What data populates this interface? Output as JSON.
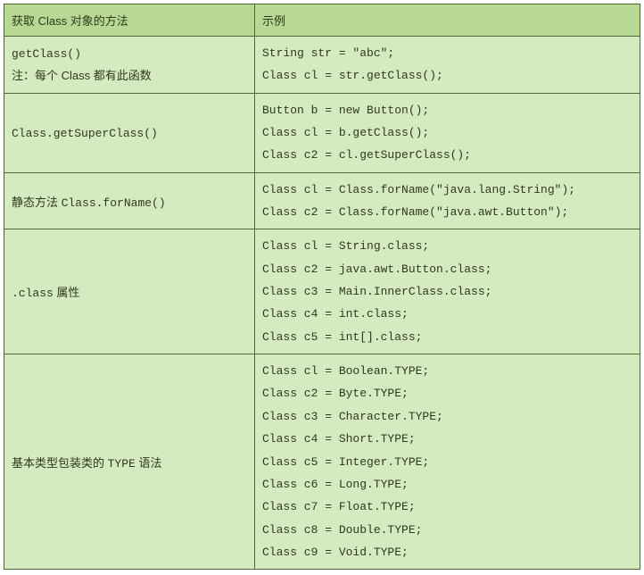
{
  "headers": {
    "method": "获取 Class 对象的方法",
    "example": "示例"
  },
  "rows": [
    {
      "method_html": "<span class=\"mono\">getClass()</span><div class=\"note\">注：每个 Class 都有此函数</div>",
      "example": "String str = \"abc\";\nClass cl = str.getClass();"
    },
    {
      "method_html": "<span class=\"mono\">Class.getSuperClass()</span>",
      "example": "Button b = new Button();\nClass cl = b.getClass();\nClass c2 = cl.getSuperClass();"
    },
    {
      "method_html": "静态方法 <span class=\"mono\">Class.forName()</span>",
      "example": "Class cl = Class.forName(\"java.lang.String\");\nClass c2 = Class.forName(\"java.awt.Button\");"
    },
    {
      "method_html": "<span class=\"mono\">.class</span> 属性",
      "example": "Class cl = String.class;\nClass c2 = java.awt.Button.class;\nClass c3 = Main.InnerClass.class;\nClass c4 = int.class;\nClass c5 = int[].class;"
    },
    {
      "method_html": "基本类型包装类的 <span class=\"mono\">TYPE</span> 语法",
      "example": "Class cl = Boolean.TYPE;\nClass c2 = Byte.TYPE;\nClass c3 = Character.TYPE;\nClass c4 = Short.TYPE;\nClass c5 = Integer.TYPE;\nClass c6 = Long.TYPE;\nClass c7 = Float.TYPE;\nClass c8 = Double.TYPE;\nClass c9 = Void.TYPE;"
    }
  ]
}
